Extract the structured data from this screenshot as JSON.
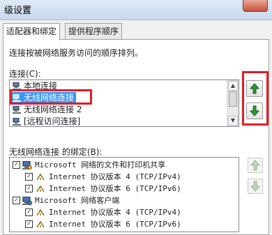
{
  "window": {
    "title": "级设置"
  },
  "tabs": [
    {
      "label": "适配器和绑定",
      "active": true
    },
    {
      "label": "提供程序顺序",
      "active": false
    }
  ],
  "main": {
    "description": "连接按被网络服务访问的顺序排列。",
    "connections_label": "连接(C):",
    "connections": [
      {
        "label": "本地连接",
        "icon": "network-computer-icon",
        "selected": false
      },
      {
        "label": "无线网络连接",
        "icon": "network-computer-icon",
        "selected": true
      },
      {
        "label": "无线网络连接 2",
        "icon": "network-computer-icon",
        "selected": false
      },
      {
        "label": "[远程访问连接]",
        "icon": "network-computer-icon",
        "selected": false
      }
    ],
    "bindings_label": "无线网络连接 的绑定(B):",
    "bindings": [
      {
        "label": "Microsoft 网络的文件和打印机共享",
        "checked": true,
        "level": 0,
        "icon": "computer-share-icon"
      },
      {
        "label": "Internet 协议版本 4 (TCP/IPv4)",
        "checked": true,
        "level": 1,
        "icon": "protocol-icon"
      },
      {
        "label": "Internet 协议版本 6 (TCP/IPv6)",
        "checked": true,
        "level": 1,
        "icon": "protocol-icon"
      },
      {
        "label": "Microsoft 网络客户端",
        "checked": true,
        "level": 0,
        "icon": "computer-client-icon"
      },
      {
        "label": "Internet 协议版本 4 (TCP/IPv4)",
        "checked": true,
        "level": 1,
        "icon": "protocol-icon"
      },
      {
        "label": "Internet 协议版本 6 (TCP/IPv6)",
        "checked": true,
        "level": 1,
        "icon": "protocol-icon"
      }
    ]
  },
  "colors": {
    "accent_selected": "#3399ff",
    "highlight_box": "#e31c23",
    "arrow_green": "#2f9a2f"
  }
}
